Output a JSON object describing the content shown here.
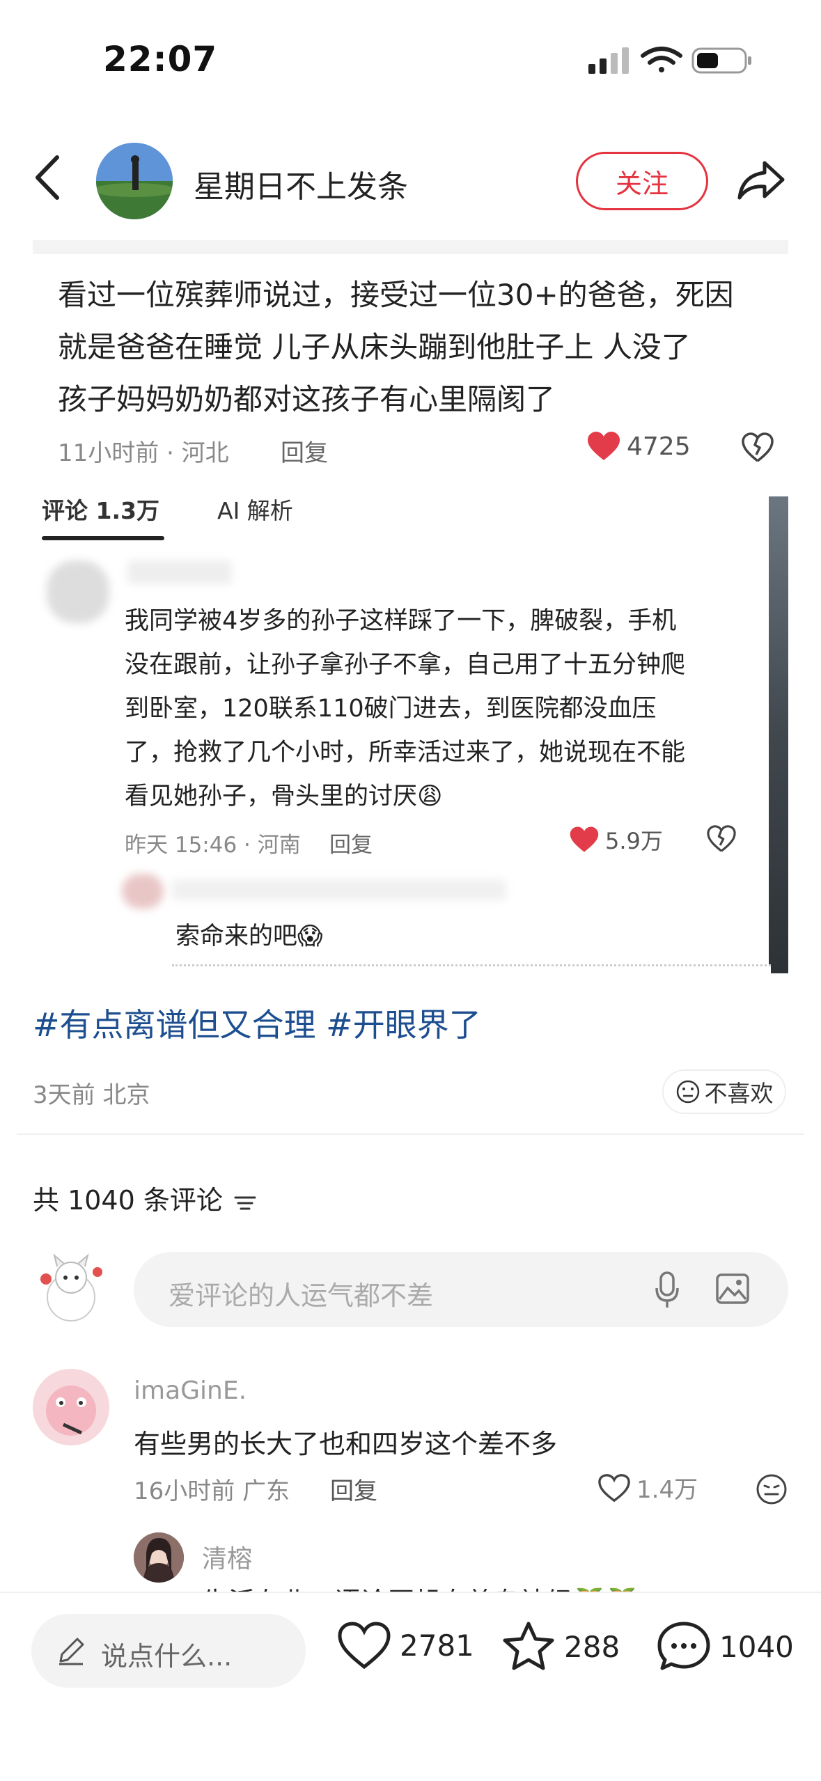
{
  "status_bar": {
    "time": "22:07"
  },
  "header": {
    "author": "星期日不上发条",
    "follow_label": "关注"
  },
  "embedded": {
    "main_comment": {
      "lines": [
        "看过一位殡葬师说过，接受过一位30+的爸爸，死因",
        "就是爸爸在睡觉  儿子从床头蹦到他肚子上  人没了",
        "孩子妈妈奶奶都对这孩子有心里隔阂了"
      ],
      "meta": "11小时前 · 河北",
      "reply": "回复",
      "likes": "4725"
    },
    "tabs": [
      "评论 1.3万",
      "AI 解析"
    ],
    "sub_comment": {
      "lines": [
        "我同学被4岁多的孙子这样踩了一下，脾破裂，手机",
        "没在跟前，让孙子拿孙子不拿，自己用了十五分钟爬",
        "到卧室，120联系110破门进去，到医院都没血压",
        "了，抢救了几个小时，所幸活过来了，她说现在不能",
        "看见她孙子，骨头里的讨厌😩"
      ],
      "meta": "昨天 15:46 · 河南",
      "reply": "回复",
      "likes": "5.9万"
    },
    "reply_comment": {
      "text": "索命来的吧😱"
    }
  },
  "post": {
    "hashtags": "#有点离谱但又合理 #开眼界了",
    "date": "3天前 北京",
    "dislike_label": "不喜欢"
  },
  "comments_section": {
    "count_label": "共 1040 条评论",
    "input_placeholder": "爱评论的人运气都不差",
    "items": [
      {
        "user": "imaGinE.",
        "text": "有些男的长大了也和四岁这个差不多",
        "meta": "16小时前 广东",
        "reply": "回复",
        "likes": "1.4万"
      },
      {
        "user": "清榕",
        "text": "生活在北，语论压起自差乌神经🍑🍑"
      }
    ]
  },
  "bottom_bar": {
    "say_placeholder": "说点什么...",
    "likes": "2781",
    "stars": "288",
    "comments": "1040"
  },
  "colors": {
    "accent_red": "#e5333f",
    "hashtag_blue": "#1d4e8f",
    "heart_red": "#e23c4a"
  }
}
